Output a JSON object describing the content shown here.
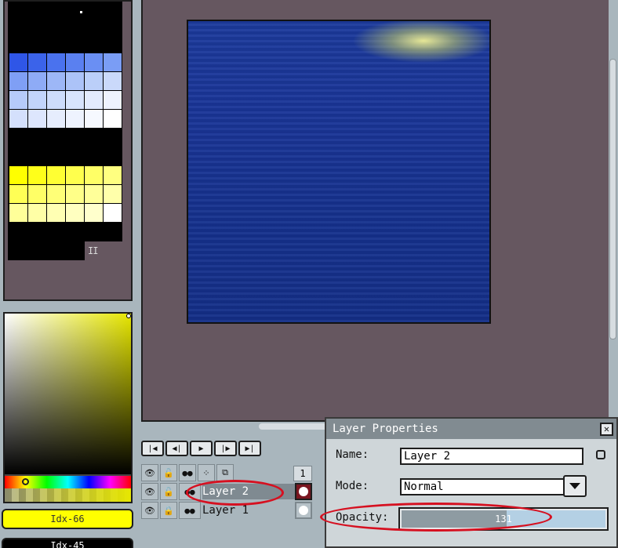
{
  "palette": {
    "blue_rows": [
      [
        "#2f56e7",
        "#3b63ea",
        "#4a72ee",
        "#5a80f0",
        "#6a8ff3",
        "#7a9df5"
      ],
      [
        "#7f9ff5",
        "#8eabf6",
        "#9db7f7",
        "#acc3f8",
        "#bbcff9",
        "#cad9fa"
      ],
      [
        "#b6cbfa",
        "#c2d4fb",
        "#cddcfb",
        "#d8e4fc",
        "#e3ebfd",
        "#eef3fe"
      ],
      [
        "#d4e0fc",
        "#dde6fd",
        "#e6edfd",
        "#eef3fe",
        "#f6f9ff",
        "#ffffff"
      ]
    ],
    "yellow_rows": [
      [
        "#ffff00",
        "#ffff1a",
        "#ffff33",
        "#ffff4d",
        "#ffff66",
        "#ffff80"
      ],
      [
        "#ffff55",
        "#ffff66",
        "#ffff77",
        "#ffff88",
        "#ffff99",
        "#ffffaa"
      ],
      [
        "#ffff99",
        "#ffffa6",
        "#ffffb3",
        "#ffffc0",
        "#ffffcc",
        "#ffffff"
      ]
    ],
    "marker_text": "II"
  },
  "color_picker": {
    "hue_color": "#e6e600"
  },
  "index_labels": {
    "foreground": "Idx-66",
    "background": "Idx-45"
  },
  "transport": {
    "buttons": [
      "first-frame-icon",
      "prev-frame-icon",
      "play-icon",
      "next-frame-icon",
      "last-frame-icon"
    ]
  },
  "layers": {
    "frame_number": "1",
    "items": [
      {
        "name": "Layer 2",
        "active": true
      },
      {
        "name": "Layer 1",
        "active": false
      }
    ]
  },
  "dialog": {
    "title": "Layer Properties",
    "name_label": "Name:",
    "name_value": "Layer 2",
    "mode_label": "Mode:",
    "mode_value": "Normal",
    "opacity_label": "Opacity:",
    "opacity_value": "131",
    "opacity_fraction": 0.514
  },
  "colors": {
    "annotation": "#d61020",
    "viewport_bg": "#665760",
    "ui_bg": "#a9b6bd"
  }
}
